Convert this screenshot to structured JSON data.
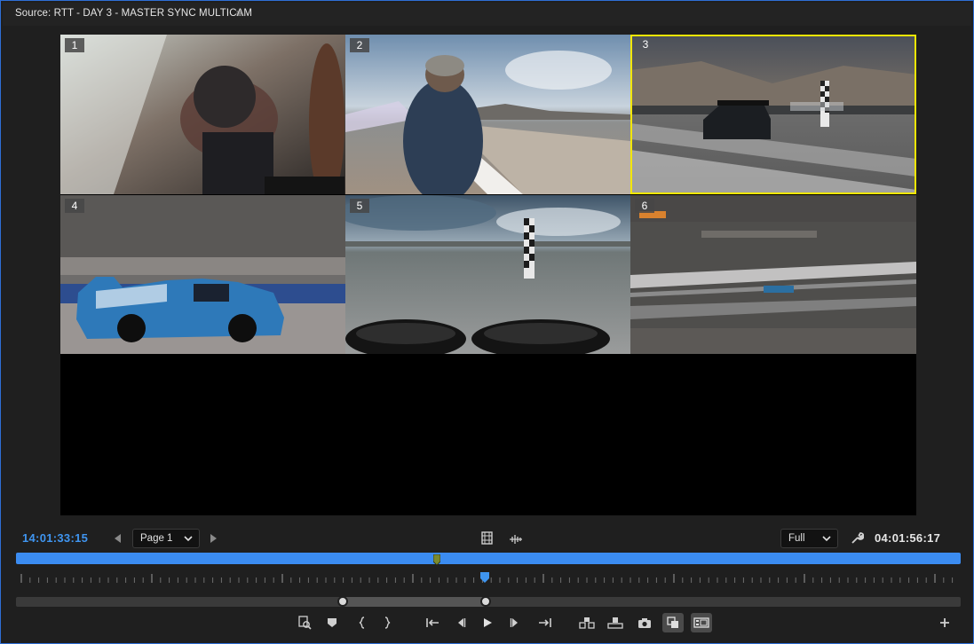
{
  "panel": {
    "title": "Source: RTT - DAY 3 - MASTER SYNC MULTICAM",
    "menu_icon": "hamburger-icon"
  },
  "multicam": {
    "selected_camera": 3,
    "cells": [
      {
        "label": "1"
      },
      {
        "label": "2"
      },
      {
        "label": "3"
      },
      {
        "label": "4"
      },
      {
        "label": "5"
      },
      {
        "label": "6"
      }
    ],
    "selected_color": "#f2e600"
  },
  "controls": {
    "playhead_timecode": "14:01:33:15",
    "duration_timecode": "04:01:56:17",
    "page_select": {
      "value": "Page 1"
    },
    "zoom_select": {
      "value": "Full"
    },
    "timecode_color": "#3f95f0",
    "scrub_color": "#3b8cf1"
  },
  "transport": {
    "buttons": [
      {
        "name": "add-marker-icon"
      },
      {
        "name": "marker-icon"
      },
      {
        "name": "mark-in-icon"
      },
      {
        "name": "mark-out-icon"
      },
      {
        "name": "go-to-in-icon"
      },
      {
        "name": "step-back-icon"
      },
      {
        "name": "play-icon"
      },
      {
        "name": "step-forward-icon"
      },
      {
        "name": "go-to-out-icon"
      },
      {
        "name": "insert-icon"
      },
      {
        "name": "overwrite-icon"
      },
      {
        "name": "export-frame-icon"
      },
      {
        "name": "toggle-multicam-icon"
      },
      {
        "name": "proxy-toggle-icon"
      },
      {
        "name": "add-button-icon"
      }
    ]
  }
}
